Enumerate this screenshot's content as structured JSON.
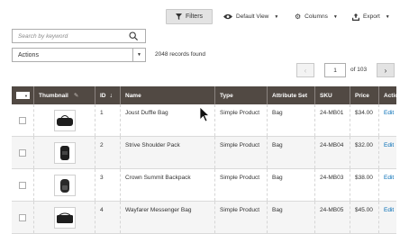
{
  "toolbar": {
    "filters_label": "Filters",
    "view_label": "Default View",
    "columns_label": "Columns",
    "export_label": "Export"
  },
  "search": {
    "placeholder": "Search by keyword"
  },
  "actions": {
    "label": "Actions"
  },
  "records_found": "2048 records found",
  "pagination": {
    "current_page": "1",
    "of_label": "of 103"
  },
  "grid": {
    "columns": [
      "Thumbnail",
      "ID",
      "Name",
      "Type",
      "Attribute Set",
      "SKU",
      "Price",
      "Action"
    ],
    "rows": [
      {
        "id": "1",
        "name": "Joust Duffle Bag",
        "type": "Simple Product",
        "attribute_set": "Bag",
        "sku": "24-MB01",
        "price": "$34.00",
        "action": "Edit"
      },
      {
        "id": "2",
        "name": "Strive Shoulder Pack",
        "type": "Simple Product",
        "attribute_set": "Bag",
        "sku": "24-MB04",
        "price": "$32.00",
        "action": "Edit"
      },
      {
        "id": "3",
        "name": "Crown Summit Backpack",
        "type": "Simple Product",
        "attribute_set": "Bag",
        "sku": "24-MB03",
        "price": "$38.00",
        "action": "Edit"
      },
      {
        "id": "4",
        "name": "Wayfarer Messenger Bag",
        "type": "Simple Product",
        "attribute_set": "Bag",
        "sku": "24-MB05",
        "price": "$45.00",
        "action": "Edit"
      }
    ]
  },
  "colors": {
    "header_bg": "#514943",
    "link": "#006bb4",
    "row_alt": "#f5f5f5"
  }
}
